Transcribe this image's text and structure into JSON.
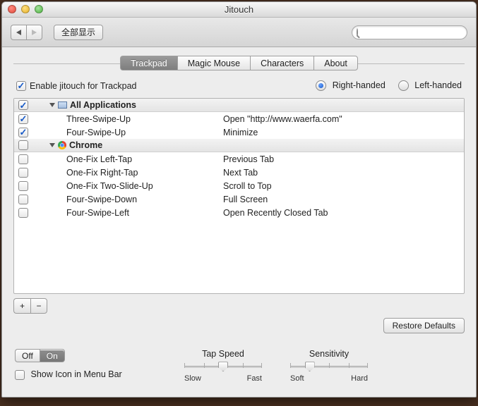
{
  "window": {
    "title": "Jitouch"
  },
  "toolbar": {
    "show_all": "全部显示",
    "search_placeholder": ""
  },
  "tabs": {
    "items": [
      "Trackpad",
      "Magic Mouse",
      "Characters",
      "About"
    ],
    "active": 0
  },
  "enable": {
    "label": "Enable jitouch for Trackpad",
    "checked": true
  },
  "handed": {
    "right_label": "Right-handed",
    "left_label": "Left-handed",
    "selected": "right"
  },
  "groups": [
    {
      "name": "All Applications",
      "checked": true,
      "icon": "app",
      "rows": [
        {
          "checked": true,
          "gesture": "Three-Swipe-Up",
          "action": "Open \"http://www.waerfa.com\""
        },
        {
          "checked": true,
          "gesture": "Four-Swipe-Up",
          "action": "Minimize"
        }
      ]
    },
    {
      "name": "Chrome",
      "checked": false,
      "icon": "chrome",
      "rows": [
        {
          "checked": false,
          "gesture": "One-Fix Left-Tap",
          "action": "Previous Tab"
        },
        {
          "checked": false,
          "gesture": "One-Fix Right-Tap",
          "action": "Next Tab"
        },
        {
          "checked": false,
          "gesture": "One-Fix Two-Slide-Up",
          "action": "Scroll to Top"
        },
        {
          "checked": false,
          "gesture": "Four-Swipe-Down",
          "action": "Full Screen"
        },
        {
          "checked": false,
          "gesture": "Four-Swipe-Left",
          "action": "Open Recently Closed Tab"
        }
      ]
    }
  ],
  "buttons": {
    "add": "+",
    "remove": "−",
    "restore": "Restore Defaults",
    "off": "Off",
    "on": "On"
  },
  "menubar": {
    "label": "Show Icon in Menu Bar",
    "checked": false
  },
  "sliders": {
    "tap_speed": {
      "title": "Tap Speed",
      "low": "Slow",
      "high": "Fast",
      "pos": 50
    },
    "sensitivity": {
      "title": "Sensitivity",
      "low": "Soft",
      "high": "Hard",
      "pos": 25
    }
  },
  "onoff_active": "on"
}
